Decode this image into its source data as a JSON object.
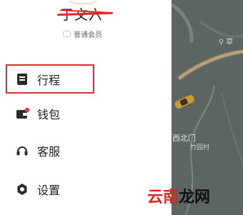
{
  "profile": {
    "name": "于文六",
    "member_label": "普通会员"
  },
  "menu": {
    "trips": "行程",
    "wallet": "钱包",
    "service": "客服",
    "settings": "设置"
  },
  "map": {
    "poi_top": "草",
    "place_main": "西北门",
    "place_sub": "竹园村"
  },
  "watermark": {
    "part1": "云南",
    "part2": "龙网"
  }
}
